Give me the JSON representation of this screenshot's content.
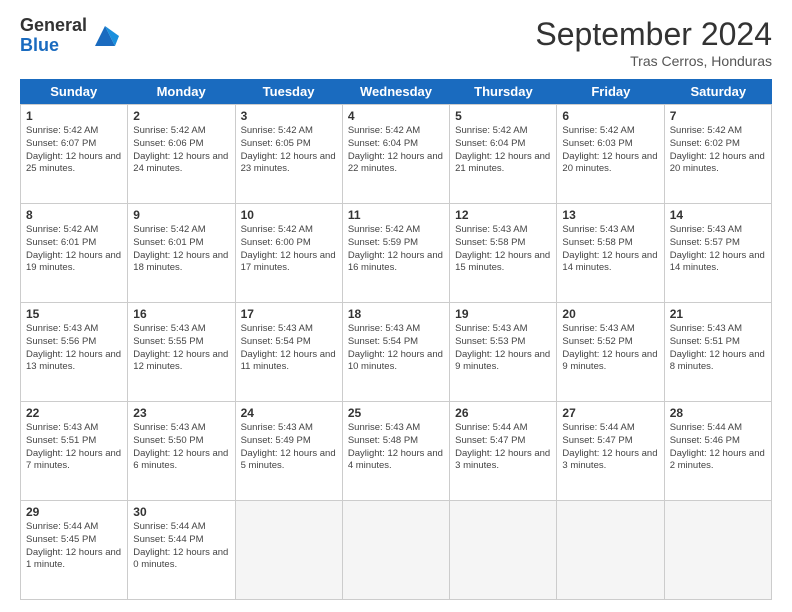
{
  "header": {
    "logo_general": "General",
    "logo_blue": "Blue",
    "month_title": "September 2024",
    "location": "Tras Cerros, Honduras"
  },
  "calendar": {
    "days_of_week": [
      "Sunday",
      "Monday",
      "Tuesday",
      "Wednesday",
      "Thursday",
      "Friday",
      "Saturday"
    ],
    "weeks": [
      [
        {
          "day": "",
          "empty": true
        },
        {
          "day": "",
          "empty": true
        },
        {
          "day": "",
          "empty": true
        },
        {
          "day": "",
          "empty": true
        },
        {
          "day": "",
          "empty": true
        },
        {
          "day": "",
          "empty": true
        },
        {
          "day": "",
          "empty": true
        }
      ],
      [
        {
          "day": "1",
          "sunrise": "5:42 AM",
          "sunset": "6:07 PM",
          "daylight": "12 hours and 25 minutes."
        },
        {
          "day": "2",
          "sunrise": "5:42 AM",
          "sunset": "6:06 PM",
          "daylight": "12 hours and 24 minutes."
        },
        {
          "day": "3",
          "sunrise": "5:42 AM",
          "sunset": "6:05 PM",
          "daylight": "12 hours and 23 minutes."
        },
        {
          "day": "4",
          "sunrise": "5:42 AM",
          "sunset": "6:04 PM",
          "daylight": "12 hours and 22 minutes."
        },
        {
          "day": "5",
          "sunrise": "5:42 AM",
          "sunset": "6:04 PM",
          "daylight": "12 hours and 21 minutes."
        },
        {
          "day": "6",
          "sunrise": "5:42 AM",
          "sunset": "6:03 PM",
          "daylight": "12 hours and 20 minutes."
        },
        {
          "day": "7",
          "sunrise": "5:42 AM",
          "sunset": "6:02 PM",
          "daylight": "12 hours and 20 minutes."
        }
      ],
      [
        {
          "day": "8",
          "sunrise": "5:42 AM",
          "sunset": "6:01 PM",
          "daylight": "12 hours and 19 minutes."
        },
        {
          "day": "9",
          "sunrise": "5:42 AM",
          "sunset": "6:01 PM",
          "daylight": "12 hours and 18 minutes."
        },
        {
          "day": "10",
          "sunrise": "5:42 AM",
          "sunset": "6:00 PM",
          "daylight": "12 hours and 17 minutes."
        },
        {
          "day": "11",
          "sunrise": "5:42 AM",
          "sunset": "5:59 PM",
          "daylight": "12 hours and 16 minutes."
        },
        {
          "day": "12",
          "sunrise": "5:43 AM",
          "sunset": "5:58 PM",
          "daylight": "12 hours and 15 minutes."
        },
        {
          "day": "13",
          "sunrise": "5:43 AM",
          "sunset": "5:58 PM",
          "daylight": "12 hours and 14 minutes."
        },
        {
          "day": "14",
          "sunrise": "5:43 AM",
          "sunset": "5:57 PM",
          "daylight": "12 hours and 14 minutes."
        }
      ],
      [
        {
          "day": "15",
          "sunrise": "5:43 AM",
          "sunset": "5:56 PM",
          "daylight": "12 hours and 13 minutes."
        },
        {
          "day": "16",
          "sunrise": "5:43 AM",
          "sunset": "5:55 PM",
          "daylight": "12 hours and 12 minutes."
        },
        {
          "day": "17",
          "sunrise": "5:43 AM",
          "sunset": "5:54 PM",
          "daylight": "12 hours and 11 minutes."
        },
        {
          "day": "18",
          "sunrise": "5:43 AM",
          "sunset": "5:54 PM",
          "daylight": "12 hours and 10 minutes."
        },
        {
          "day": "19",
          "sunrise": "5:43 AM",
          "sunset": "5:53 PM",
          "daylight": "12 hours and 9 minutes."
        },
        {
          "day": "20",
          "sunrise": "5:43 AM",
          "sunset": "5:52 PM",
          "daylight": "12 hours and 9 minutes."
        },
        {
          "day": "21",
          "sunrise": "5:43 AM",
          "sunset": "5:51 PM",
          "daylight": "12 hours and 8 minutes."
        }
      ],
      [
        {
          "day": "22",
          "sunrise": "5:43 AM",
          "sunset": "5:51 PM",
          "daylight": "12 hours and 7 minutes."
        },
        {
          "day": "23",
          "sunrise": "5:43 AM",
          "sunset": "5:50 PM",
          "daylight": "12 hours and 6 minutes."
        },
        {
          "day": "24",
          "sunrise": "5:43 AM",
          "sunset": "5:49 PM",
          "daylight": "12 hours and 5 minutes."
        },
        {
          "day": "25",
          "sunrise": "5:43 AM",
          "sunset": "5:48 PM",
          "daylight": "12 hours and 4 minutes."
        },
        {
          "day": "26",
          "sunrise": "5:44 AM",
          "sunset": "5:47 PM",
          "daylight": "12 hours and 3 minutes."
        },
        {
          "day": "27",
          "sunrise": "5:44 AM",
          "sunset": "5:47 PM",
          "daylight": "12 hours and 3 minutes."
        },
        {
          "day": "28",
          "sunrise": "5:44 AM",
          "sunset": "5:46 PM",
          "daylight": "12 hours and 2 minutes."
        }
      ],
      [
        {
          "day": "29",
          "sunrise": "5:44 AM",
          "sunset": "5:45 PM",
          "daylight": "12 hours and 1 minute."
        },
        {
          "day": "30",
          "sunrise": "5:44 AM",
          "sunset": "5:44 PM",
          "daylight": "12 hours and 0 minutes."
        },
        {
          "day": "",
          "empty": true
        },
        {
          "day": "",
          "empty": true
        },
        {
          "day": "",
          "empty": true
        },
        {
          "day": "",
          "empty": true
        },
        {
          "day": "",
          "empty": true
        }
      ]
    ],
    "labels": {
      "sunrise": "Sunrise:",
      "sunset": "Sunset:",
      "daylight": "Daylight:"
    }
  }
}
